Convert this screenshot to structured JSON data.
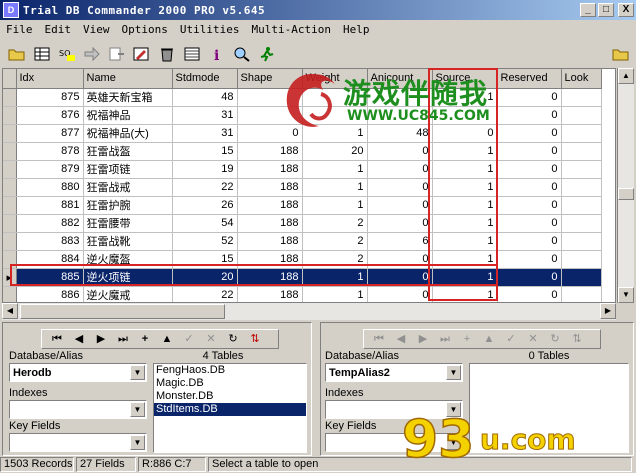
{
  "window": {
    "title": "Trial DB Commander 2000 PRO v5.645",
    "minimize": "_",
    "maximize": "□",
    "close": "X"
  },
  "menu": [
    "File",
    "Edit",
    "View",
    "Options",
    "Utilities",
    "Multi-Action",
    "Help"
  ],
  "toolbar": {
    "icons": [
      "open-folder-icon",
      "table-icon",
      "sql-icon",
      "arrow-right-icon",
      "export-icon",
      "edit-icon",
      "delete-icon",
      "grid-icon",
      "info-icon",
      "search-icon",
      "run-icon"
    ],
    "right_icon": "open-folder-icon"
  },
  "grid": {
    "columns": [
      "Idx",
      "Name",
      "Stdmode",
      "Shape",
      "Weight",
      "Anicount",
      "Source",
      "Reserved",
      "Look"
    ],
    "rows": [
      [
        "875",
        "英雄天新宝箱",
        "48",
        "",
        "",
        "",
        "1",
        "0",
        ""
      ],
      [
        "876",
        "祝福神品",
        "31",
        "",
        "",
        "",
        "",
        "0",
        ""
      ],
      [
        "877",
        "祝福神品(大)",
        "31",
        "0",
        "1",
        "48",
        "0",
        "0",
        ""
      ],
      [
        "878",
        "狂雷战盔",
        "15",
        "188",
        "20",
        "0",
        "1",
        "0",
        ""
      ],
      [
        "879",
        "狂雷项链",
        "19",
        "188",
        "1",
        "0",
        "1",
        "0",
        ""
      ],
      [
        "880",
        "狂雷战戒",
        "22",
        "188",
        "1",
        "0",
        "1",
        "0",
        ""
      ],
      [
        "881",
        "狂雷护腕",
        "26",
        "188",
        "1",
        "0",
        "1",
        "0",
        ""
      ],
      [
        "882",
        "狂雷腰带",
        "54",
        "188",
        "2",
        "0",
        "1",
        "0",
        ""
      ],
      [
        "883",
        "狂雷战靴",
        "52",
        "188",
        "2",
        "6",
        "1",
        "0",
        ""
      ],
      [
        "884",
        "逆火魔盔",
        "15",
        "188",
        "2",
        "0",
        "1",
        "0",
        ""
      ],
      [
        "885",
        "逆火项链",
        "20",
        "188",
        "1",
        "0",
        "1",
        "0",
        ""
      ],
      [
        "886",
        "逆火魔戒",
        "22",
        "188",
        "1",
        "0",
        "1",
        "0",
        ""
      ]
    ],
    "selected_index": 10
  },
  "left_panel": {
    "nav": [
      "⏮",
      "◀",
      "▶",
      "⏭",
      "+",
      "▲",
      "✓",
      "✕",
      "↻",
      "⇅"
    ],
    "db_label": "Database/Alias",
    "db_value": "Herodb",
    "indexes_label": "Indexes",
    "keyfields_label": "Key Fields",
    "tables_header": "4 Tables",
    "tables": [
      "FengHaos.DB",
      "Magic.DB",
      "Monster.DB",
      "StdItems.DB"
    ],
    "selected_table": 3
  },
  "right_panel": {
    "nav": [
      "⏮",
      "◀",
      "▶",
      "⏭",
      "+",
      "▲",
      "✓",
      "✕",
      "↻",
      "⇅"
    ],
    "db_label": "Database/Alias",
    "db_value": "TempAlias2",
    "indexes_label": "Indexes",
    "keyfields_label": "Key Fields",
    "tables_header": "0 Tables"
  },
  "status": {
    "records": "1503 Records",
    "fields": "27 Fields",
    "position": "R:886 C:7",
    "message": "Select a table to open"
  },
  "watermarks": {
    "site_name": "游戏伴随我",
    "site_url": "WWW.UC845.COM",
    "logo_text": "93",
    "logo_suffix": "u.com"
  },
  "colors": {
    "selection": "#0a246a",
    "highlight_box": "#d62424",
    "watermark_green": "#1e8f1e"
  }
}
